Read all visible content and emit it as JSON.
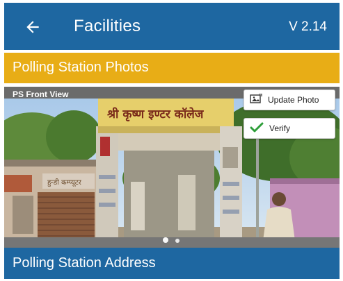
{
  "appbar": {
    "title": "Facilities",
    "version": "V 2.14",
    "back_icon": "arrow-left-icon"
  },
  "photos_section": {
    "title": "Polling Station Photos",
    "color": "#e8ad16",
    "photo_caption": "PS Front View",
    "sign_text": "श्री कृष्ण इण्टर कॉलेज",
    "update_button": "Update Photo",
    "verify_button": "Verify",
    "carousel": {
      "total": 2,
      "active": 1
    }
  },
  "address_section": {
    "title": "Polling Station Address",
    "color": "#1e67a1"
  }
}
